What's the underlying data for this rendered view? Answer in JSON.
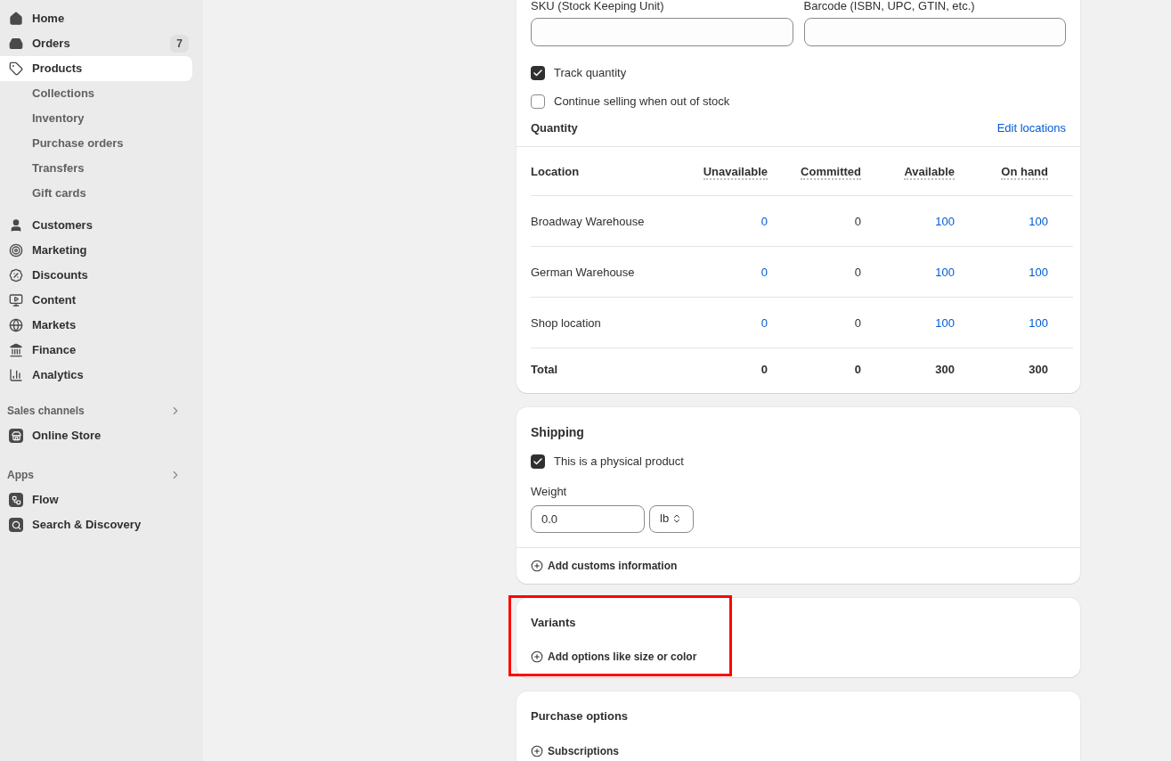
{
  "sidebar": {
    "items": [
      {
        "label": "Home",
        "selected": false
      },
      {
        "label": "Orders",
        "selected": false,
        "badge": "7"
      },
      {
        "label": "Products",
        "selected": true,
        "children": [
          {
            "label": "Collections"
          },
          {
            "label": "Inventory"
          },
          {
            "label": "Purchase orders"
          },
          {
            "label": "Transfers"
          },
          {
            "label": "Gift cards"
          }
        ]
      },
      {
        "label": "Customers",
        "selected": false
      },
      {
        "label": "Marketing",
        "selected": false
      },
      {
        "label": "Discounts",
        "selected": false
      },
      {
        "label": "Content",
        "selected": false
      },
      {
        "label": "Markets",
        "selected": false
      },
      {
        "label": "Finance",
        "selected": false
      },
      {
        "label": "Analytics",
        "selected": false
      }
    ],
    "sections": [
      {
        "title": "Sales channels",
        "items": [
          {
            "label": "Online Store"
          }
        ]
      },
      {
        "title": "Apps",
        "items": [
          {
            "label": "Flow"
          },
          {
            "label": "Search & Discovery"
          }
        ]
      }
    ]
  },
  "inventory": {
    "fields": [
      {
        "label": "SKU (Stock Keeping Unit)"
      },
      {
        "label": "Barcode (ISBN, UPC, GTIN, etc.)"
      }
    ],
    "checkboxes": [
      {
        "label": "Track quantity",
        "checked": true
      },
      {
        "label": "Continue selling when out of stock",
        "checked": false
      }
    ],
    "quantity_title": "Quantity",
    "edit_link": "Edit locations",
    "table": {
      "columns": [
        {
          "label": "Location",
          "link": false
        },
        {
          "label": "Unavailable",
          "link": true
        },
        {
          "label": "Committed",
          "link": false
        },
        {
          "label": "Available",
          "link": true
        },
        {
          "label": "On hand",
          "link": true
        }
      ],
      "rows": [
        {
          "kind": "location",
          "cells": [
            "Broadway Warehouse",
            "0",
            "0",
            "100",
            "100"
          ]
        },
        {
          "kind": "location",
          "cells": [
            "German Warehouse",
            "0",
            "0",
            "100",
            "100"
          ]
        },
        {
          "kind": "location",
          "cells": [
            "Shop location",
            "0",
            "0",
            "100",
            "100"
          ]
        },
        {
          "kind": "total",
          "cells": [
            "Total",
            "0",
            "0",
            "300",
            "300"
          ]
        }
      ]
    }
  },
  "shipping": {
    "title": "Shipping",
    "checkbox": {
      "label": "This is a physical product",
      "checked": true
    },
    "weight_label": "Weight",
    "weight_value": "0.0",
    "unit": "lb",
    "action": "Add customs information"
  },
  "variants": {
    "title": "Variants",
    "action": "Add options like size or color",
    "highlighted": true
  },
  "purchase_options": {
    "title": "Purchase options",
    "action": "Subscriptions"
  }
}
